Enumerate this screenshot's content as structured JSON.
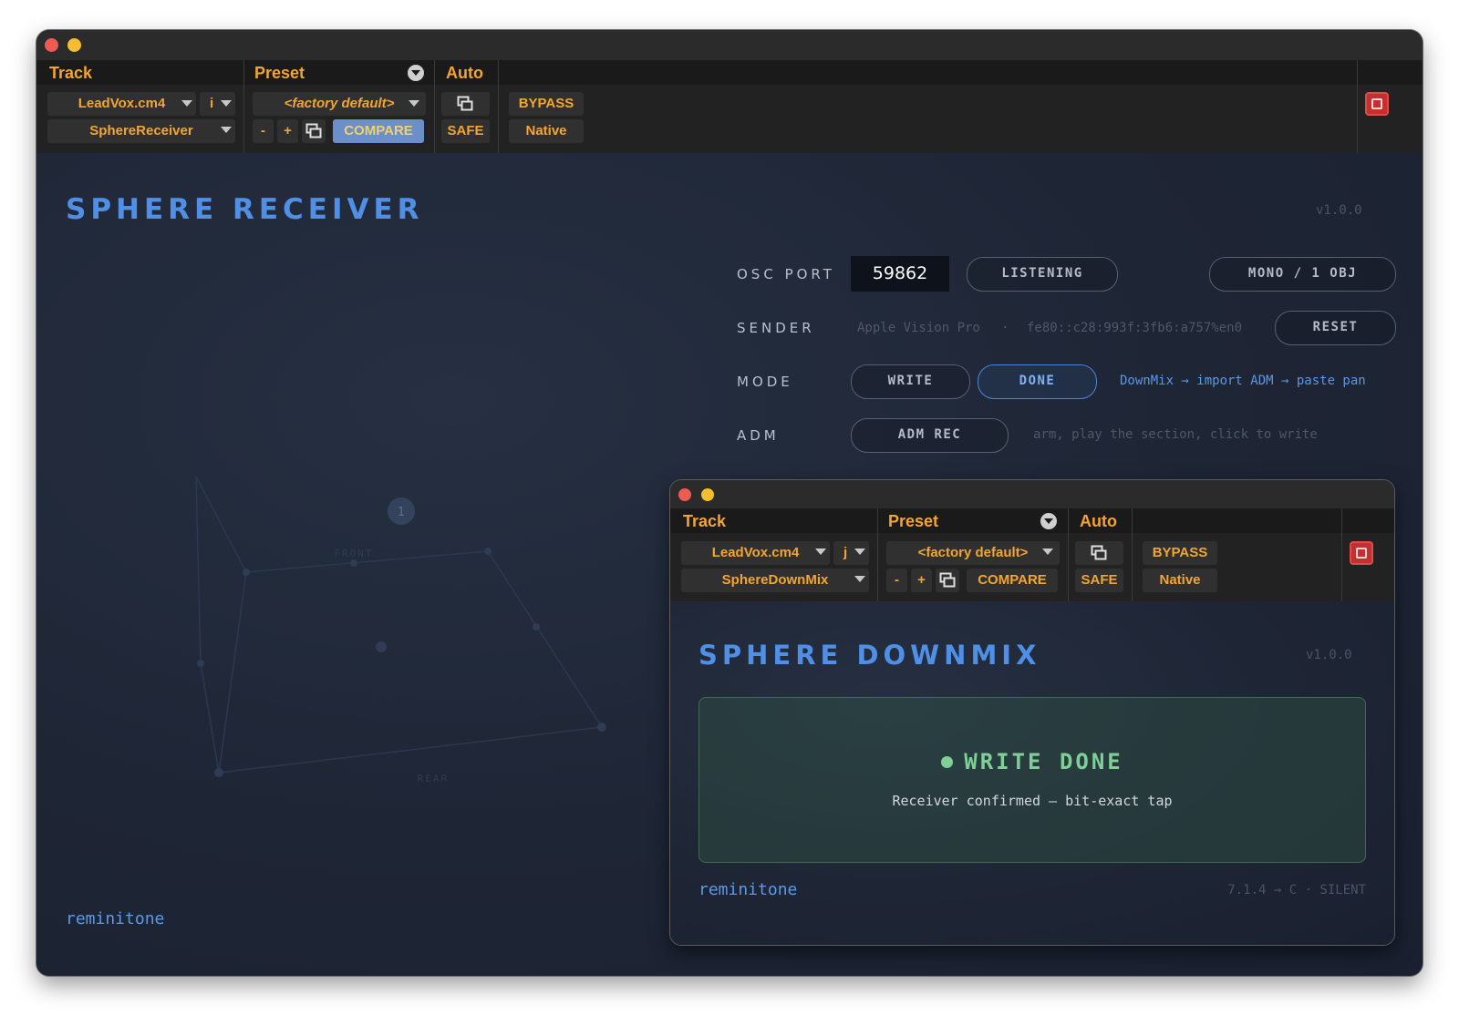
{
  "receiver_window": {
    "header": {
      "track_label": "Track",
      "preset_label": "Preset",
      "auto_label": "Auto"
    },
    "track_name": "LeadVox.cm4",
    "track_insert": "i",
    "plugin_name": "SphereReceiver",
    "preset_name": "<factory default>",
    "minus_label": "-",
    "plus_label": "+",
    "compare_label": "COMPARE",
    "bypass_label": "BYPASS",
    "safe_label": "SAFE",
    "native_label": "Native",
    "plugin": {
      "title": "SPHERE RECEIVER",
      "version": "v1.0.0",
      "osc_port_label": "OSC PORT",
      "osc_port_value": "59862",
      "listening_label": "LISTENING",
      "mono_label": "MONO / 1 OBJ",
      "sender_label": "SENDER",
      "sender_device": "Apple Vision Pro",
      "sender_separator": "·",
      "sender_address": "fe80::c28:993f:3fb6:a757%en0",
      "reset_label": "RESET",
      "mode_label": "MODE",
      "write_label": "WRITE",
      "done_label": "DONE",
      "mode_hint": "DownMix → import ADM → paste pan",
      "adm_label": "ADM",
      "adm_rec_label": "ADM REC",
      "adm_hint": "arm, play the section, click to write",
      "object_number": "1",
      "front_label": "FRONT",
      "rear_label": "REAR",
      "brand": "reminitone"
    }
  },
  "downmix_window": {
    "header": {
      "track_label": "Track",
      "preset_label": "Preset",
      "auto_label": "Auto"
    },
    "track_name": "LeadVox.cm4",
    "track_insert": "j",
    "plugin_name": "SphereDownMix",
    "preset_name": "<factory default>",
    "minus_label": "-",
    "plus_label": "+",
    "compare_label": "COMPARE",
    "bypass_label": "BYPASS",
    "safe_label": "SAFE",
    "native_label": "Native",
    "plugin": {
      "title": "SPHERE DOWNMIX",
      "version": "v1.0.0",
      "status_title": "WRITE DONE",
      "status_message": "Receiver confirmed — bit-exact tap",
      "brand": "reminitone",
      "footer_status": "7.1.4 → C · SILENT"
    }
  },
  "colors": {
    "accent_orange": "#f3a533",
    "title_blue": "#4f8fe6",
    "status_green": "#7fcf97",
    "close_red": "#ee5b52",
    "minimize_yellow": "#f5bd2f"
  }
}
